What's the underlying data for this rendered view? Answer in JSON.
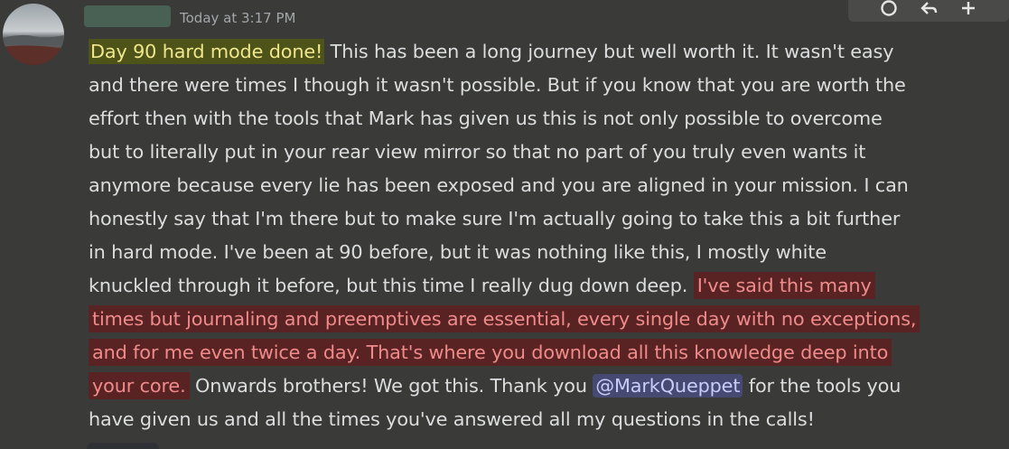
{
  "message": {
    "author_redacted": true,
    "timestamp": "Today at 3:17 PM",
    "segments": {
      "highlight_yellow": "Day 90 hard mode done!",
      "line1_rest": " This has been a long journey but well worth it.  It wasn't easy",
      "line2": "and there were times I though it wasn't possible. But if you know that you are worth the",
      "line3": "effort then with the tools that Mark has given us this is not only possible to overcome",
      "line4": "but to literally put in your rear view mirror so that no part of you truly even wants it",
      "line5": "anymore because every lie has been exposed and you are aligned in your mission.  I can",
      "line6": "honestly say that I'm there but to make sure I'm actually going to take this a bit further",
      "line7": "in hard mode.  I've been at 90 before, but it was nothing like this, I mostly white",
      "line8_start": "knuckled through it before, but this time I really dug down deep. ",
      "red_line8": "I've said this many",
      "red_line9": "times but journaling and preemptives are essential, every single day with no exceptions,",
      "red_line10": "and for me even twice a day.  That's where you download all this knowledge deep into",
      "red_line11": "your core.",
      "line11_mid": " Onwards brothers! We got this. Thank you ",
      "mention": "@MarkQueppet",
      "line11_end": " for the tools you",
      "line12": "have given us and all the times you've answered all my questions in the calls!"
    }
  },
  "toolbar": {
    "icons": [
      "add-reaction-icon",
      "reply-icon",
      "more-options-icon"
    ]
  },
  "colors": {
    "background": "#3a3a38",
    "text": "#dcddde",
    "yellow_highlight_bg": "#4d5319",
    "yellow_highlight_text": "#f0e68c",
    "red_highlight_bg": "#5a2323",
    "red_highlight_text": "#ef8b8b",
    "mention_bg": "#464a73",
    "mention_text": "#c9cdfb"
  }
}
